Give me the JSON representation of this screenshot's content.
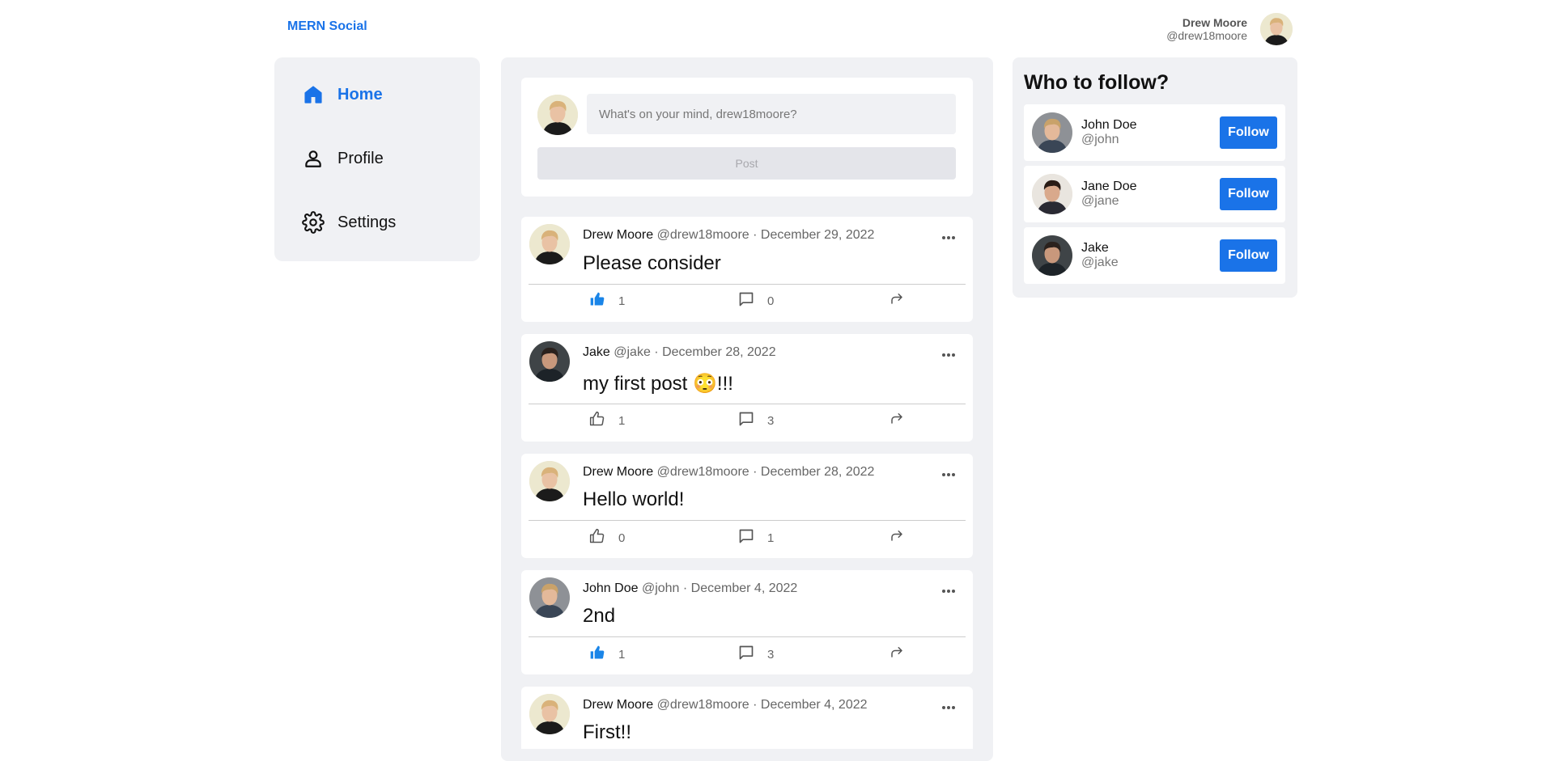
{
  "header": {
    "brand": "MERN Social",
    "user_name": "Drew Moore",
    "user_handle": "@drew18moore"
  },
  "sidebar": {
    "items": [
      {
        "label": "Home",
        "icon": "home-icon",
        "active": true
      },
      {
        "label": "Profile",
        "icon": "person-icon",
        "active": false
      },
      {
        "label": "Settings",
        "icon": "gear-icon",
        "active": false
      }
    ]
  },
  "compose": {
    "placeholder": "What's on your mind, drew18moore?",
    "post_label": "Post"
  },
  "posts": [
    {
      "author": "Drew Moore",
      "meta": "@drew18moore · December 29, 2022",
      "body": "Please consider",
      "likes": "1",
      "comments": "0",
      "liked": true,
      "avatar": "drew"
    },
    {
      "author": "Jake",
      "meta": "@jake · December 28, 2022",
      "body": "my first post 😳!!!",
      "likes": "1",
      "comments": "3",
      "liked": false,
      "avatar": "jake"
    },
    {
      "author": "Drew Moore",
      "meta": "@drew18moore · December 28, 2022",
      "body": "Hello world!",
      "likes": "0",
      "comments": "1",
      "liked": false,
      "avatar": "drew"
    },
    {
      "author": "John Doe",
      "meta": "@john · December 4, 2022",
      "body": "2nd",
      "likes": "1",
      "comments": "3",
      "liked": true,
      "avatar": "john"
    },
    {
      "author": "Drew Moore",
      "meta": "@drew18moore · December 4, 2022",
      "body": "First!!",
      "likes": "",
      "comments": "",
      "liked": false,
      "avatar": "drew"
    }
  ],
  "who_to_follow": {
    "title": "Who to follow?",
    "users": [
      {
        "name": "John Doe",
        "handle": "@john",
        "button": "Follow",
        "avatar": "john"
      },
      {
        "name": "Jane Doe",
        "handle": "@jane",
        "button": "Follow",
        "avatar": "jane"
      },
      {
        "name": "Jake",
        "handle": "@jake",
        "button": "Follow",
        "avatar": "jake"
      }
    ]
  },
  "colors": {
    "accent": "#1a73e8",
    "panel": "#f0f1f4",
    "like_active": "#1a85e8"
  }
}
